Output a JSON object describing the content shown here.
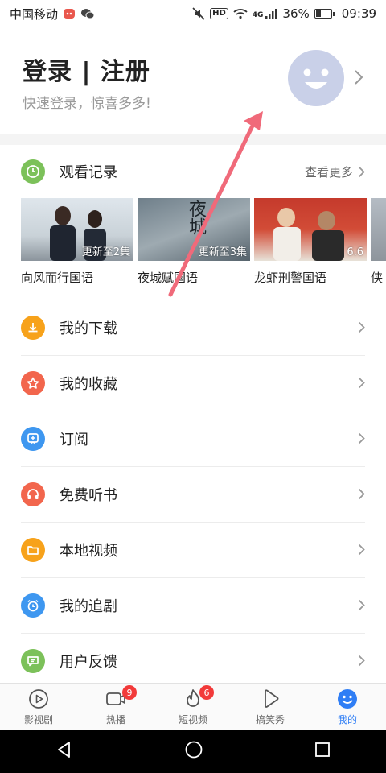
{
  "status_bar": {
    "carrier": "中国移动",
    "network": "4G",
    "battery": "36%",
    "battery_level": 0.36,
    "time": "09:39",
    "hd": "HD"
  },
  "header": {
    "title": "登录 | 注册",
    "subtitle": "快速登录，惊喜多多!"
  },
  "history": {
    "label": "观看记录",
    "more": "查看更多",
    "items": [
      {
        "title": "向风而行国语",
        "badge": "更新至2集"
      },
      {
        "title": "夜城赋国语",
        "badge": "更新至3集",
        "overlay": "夜城"
      },
      {
        "title": "龙虾刑警国语",
        "badge": "6.6"
      },
      {
        "title": "侠"
      }
    ]
  },
  "menu": {
    "items": [
      {
        "label": "我的下载",
        "icon": "download-icon",
        "color": "#f7a21b"
      },
      {
        "label": "我的收藏",
        "icon": "star-icon",
        "color": "#f2664d"
      },
      {
        "label": "订阅",
        "icon": "subscribe-icon",
        "color": "#3e97f0"
      },
      {
        "label": "免费听书",
        "icon": "headphones-icon",
        "color": "#f2664d"
      },
      {
        "label": "本地视频",
        "icon": "folder-icon",
        "color": "#f7a21b"
      },
      {
        "label": "我的追剧",
        "icon": "alarm-icon",
        "color": "#3e97f0"
      },
      {
        "label": "用户反馈",
        "icon": "feedback-icon",
        "color": "#7cc15a"
      }
    ]
  },
  "tabs": [
    {
      "label": "影视剧",
      "icon": "play-circle-icon"
    },
    {
      "label": "热播",
      "icon": "video-camera-icon",
      "badge": "9"
    },
    {
      "label": "短视频",
      "icon": "fire-icon",
      "badge": "6"
    },
    {
      "label": "搞笑秀",
      "icon": "play-triangle-icon"
    },
    {
      "label": "我的",
      "icon": "smiley-icon",
      "active": true
    }
  ],
  "colors": {
    "accent": "#2f7ef5",
    "badge": "#f23a3a",
    "history_icon": "#7cc15a",
    "avatar": "#c9d0e8",
    "annotation_arrow": "#f06a7a"
  }
}
